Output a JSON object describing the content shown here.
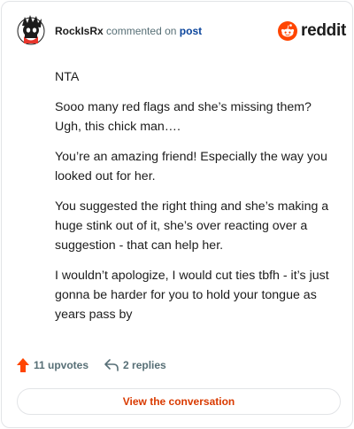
{
  "header": {
    "username": "RockIsRx",
    "action_text": "commented on",
    "post_link": "post",
    "brand": "reddit"
  },
  "comment": {
    "paragraphs": [
      "NTA",
      "Sooo many red flags and she’s missing them? Ugh, this chick man….",
      "You’re an amazing friend! Especially the way you looked out for her.",
      "You suggested the right thing and she’s making a huge stink out of it, she’s over reacting over a suggestion - that can help her.",
      "I wouldn’t apologize, I would cut ties tbfh - it’s just gonna be harder for you to hold your tongue as years pass by"
    ]
  },
  "actions": {
    "upvotes": "11 upvotes",
    "replies": "2 replies"
  },
  "cta": {
    "label": "View the conversation"
  },
  "colors": {
    "reddit_orange": "#ff4500",
    "link_blue": "#0a449b",
    "cta_orange": "#d93a00"
  }
}
